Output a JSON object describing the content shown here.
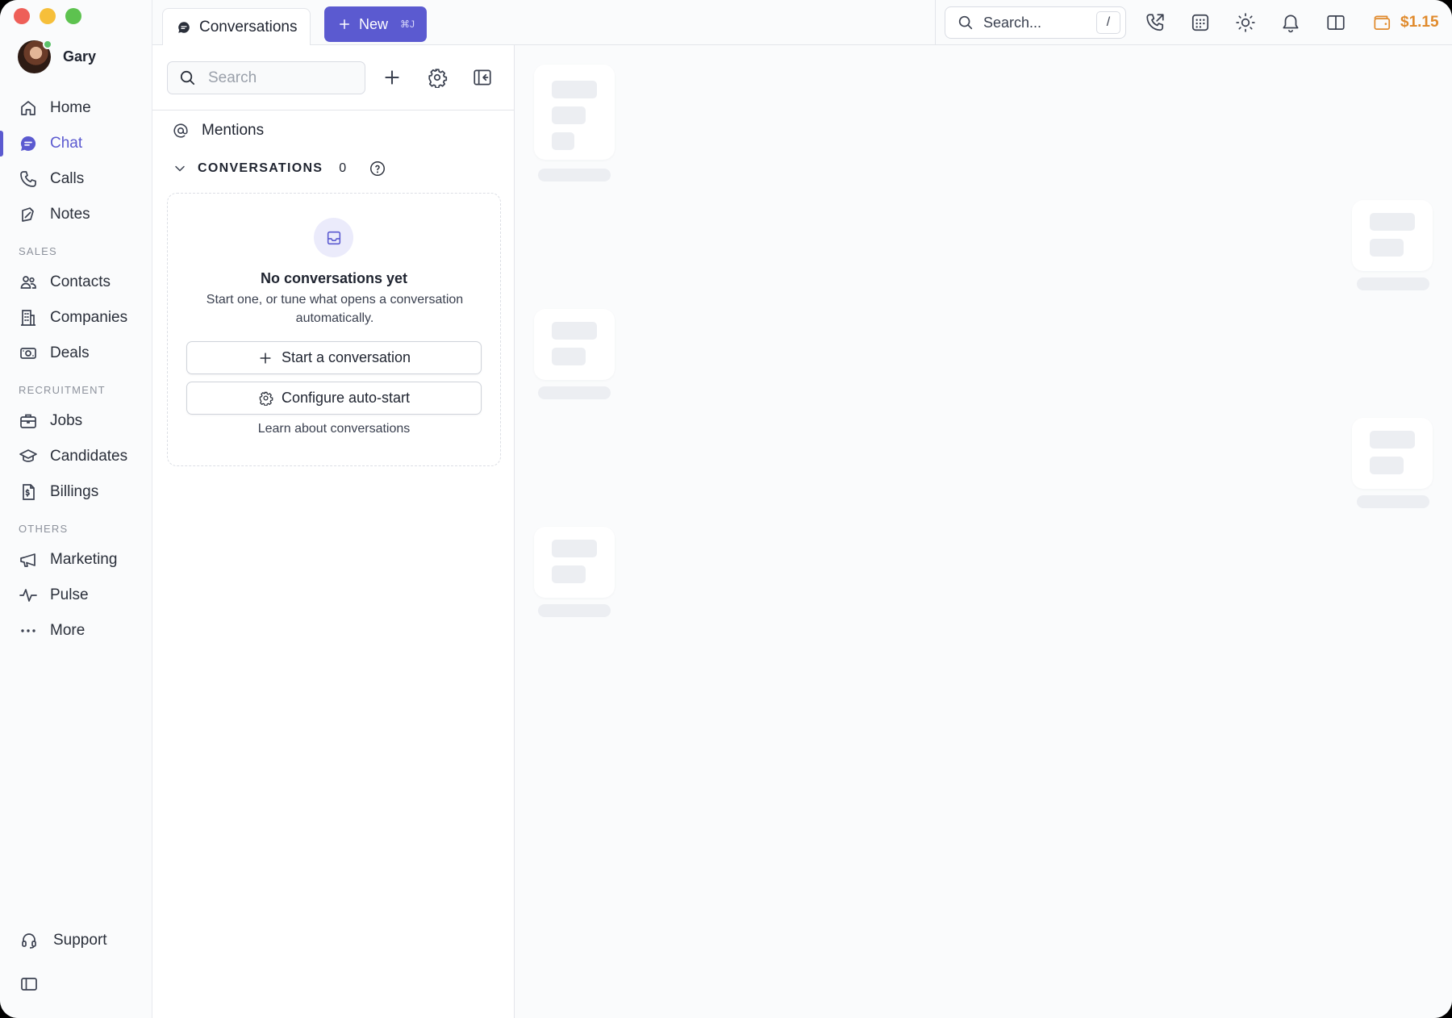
{
  "window": {
    "controls": [
      "close",
      "minimize",
      "zoom"
    ]
  },
  "profile": {
    "name": "Gary",
    "status_color": "#5cc26a"
  },
  "sidebar": {
    "items": [
      {
        "label": "Home",
        "icon": "home-icon"
      },
      {
        "label": "Chat",
        "icon": "chat-bubble-icon",
        "active": true
      },
      {
        "label": "Calls",
        "icon": "phone-icon"
      },
      {
        "label": "Notes",
        "icon": "note-icon"
      }
    ],
    "sections": [
      {
        "label": "SALES",
        "items": [
          {
            "label": "Contacts",
            "icon": "contacts-icon"
          },
          {
            "label": "Companies",
            "icon": "building-icon"
          },
          {
            "label": "Deals",
            "icon": "money-icon"
          }
        ]
      },
      {
        "label": "RECRUITMENT",
        "items": [
          {
            "label": "Jobs",
            "icon": "briefcase-icon"
          },
          {
            "label": "Candidates",
            "icon": "graduation-cap-icon"
          },
          {
            "label": "Billings",
            "icon": "invoice-icon"
          }
        ]
      },
      {
        "label": "OTHERS",
        "items": [
          {
            "label": "Marketing",
            "icon": "megaphone-icon"
          },
          {
            "label": "Pulse",
            "icon": "pulse-icon"
          },
          {
            "label": "More",
            "icon": "ellipsis-icon"
          }
        ]
      }
    ],
    "support_label": "Support",
    "accent_color": "#5b5ad0"
  },
  "topbar": {
    "tab_label": "Conversations",
    "new_button_label": "New",
    "new_button_shortcut": "⌘J",
    "search_placeholder": "Search...",
    "search_shortcut": "/",
    "balance": "$1.15",
    "icons": [
      "phone-outgoing-icon",
      "calculator-icon",
      "sun-icon",
      "bell-icon",
      "split-view-icon",
      "wallet-icon"
    ]
  },
  "conversations_panel": {
    "search_placeholder": "Search",
    "mentions_label": "Mentions",
    "section_label": "CONVERSATIONS",
    "count": "0",
    "empty_state": {
      "title": "No conversations yet",
      "subtitle": "Start one, or tune what opens a conversation automatically.",
      "primary_button": "Start a conversation",
      "secondary_button": "Configure auto-start",
      "link": "Learn about conversations"
    }
  },
  "skeleton": {
    "state": "loading"
  }
}
